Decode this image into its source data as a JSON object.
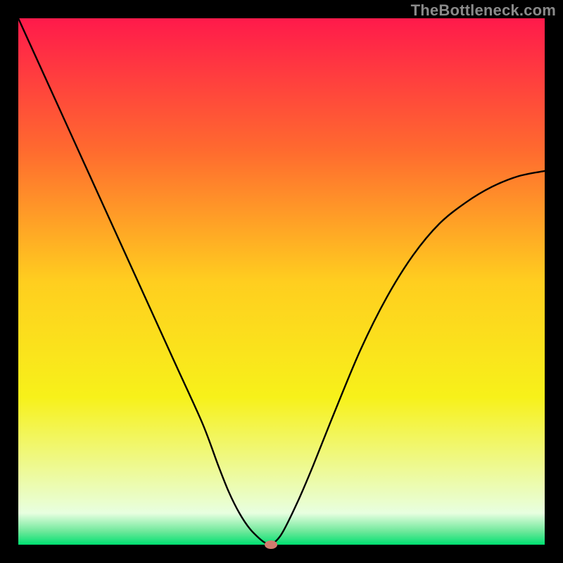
{
  "attribution": {
    "text": "TheBottleneck.com"
  },
  "chart_data": {
    "type": "line",
    "title": "",
    "xlabel": "",
    "ylabel": "",
    "xlim": [
      0,
      100
    ],
    "ylim": [
      0,
      100
    ],
    "grid": false,
    "legend": false,
    "background_gradient": {
      "type": "vertical",
      "stops": [
        {
          "pos": 0.0,
          "color": "#ff1a4b"
        },
        {
          "pos": 0.25,
          "color": "#ff6a2f"
        },
        {
          "pos": 0.5,
          "color": "#ffce1f"
        },
        {
          "pos": 0.72,
          "color": "#f7f11a"
        },
        {
          "pos": 0.94,
          "color": "#e8ffe0"
        },
        {
          "pos": 0.975,
          "color": "#6de89a"
        },
        {
          "pos": 1.0,
          "color": "#00e071"
        }
      ]
    },
    "series": [
      {
        "name": "bottleneck-curve",
        "color": "#000000",
        "x": [
          0,
          5,
          10,
          15,
          20,
          25,
          30,
          35,
          38,
          40,
          42,
          44,
          46,
          47,
          48,
          50,
          53,
          56,
          60,
          65,
          70,
          75,
          80,
          85,
          90,
          95,
          100
        ],
        "y": [
          100,
          89,
          78,
          67,
          56,
          45,
          34,
          23,
          15,
          10,
          6,
          3,
          1,
          0.3,
          0,
          2,
          8,
          15,
          25,
          37,
          47,
          55,
          61,
          65,
          68,
          70,
          71
        ]
      }
    ],
    "marker": {
      "name": "optimum-point",
      "x": 48,
      "y": 0,
      "color": "#d27b6e",
      "rx": 9,
      "ry": 6
    }
  }
}
